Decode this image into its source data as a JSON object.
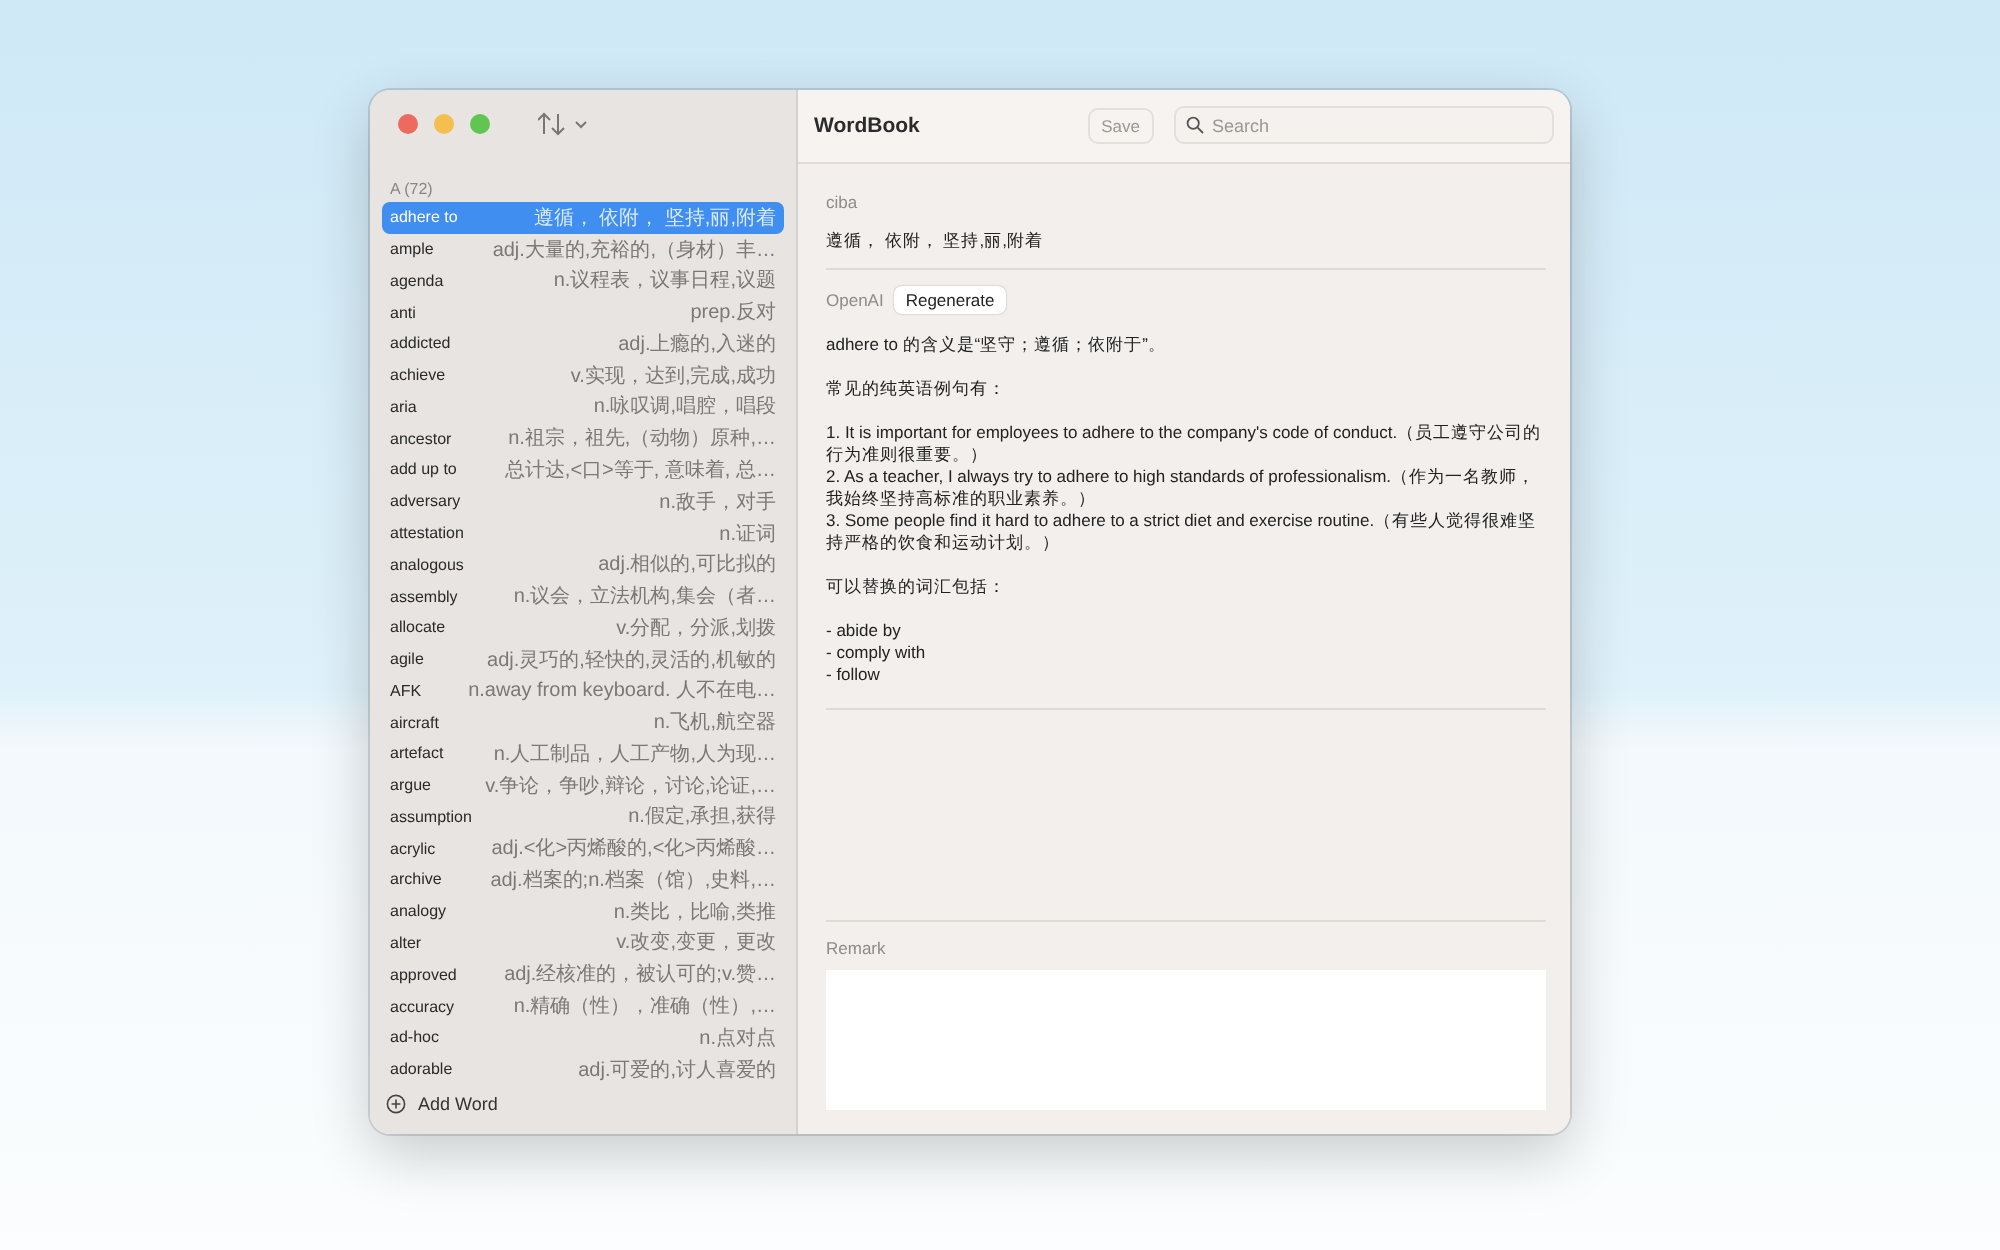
{
  "window": {
    "title": "WordBook"
  },
  "toolbar": {
    "save_label": "Save",
    "search_placeholder": "Search"
  },
  "sidebar": {
    "section": "A (72)",
    "add_label": "Add Word",
    "items": [
      {
        "word": "adhere to",
        "meaning": "遵循， 依附， 坚持,丽,附着",
        "selected": true
      },
      {
        "word": "ample",
        "meaning": "adj.大量的,充裕的,（身材）丰…",
        "selected": false
      },
      {
        "word": "agenda",
        "meaning": "n.议程表，议事日程,议题",
        "selected": false
      },
      {
        "word": "anti",
        "meaning": "prep.反对",
        "selected": false
      },
      {
        "word": "addicted",
        "meaning": "adj.上瘾的,入迷的",
        "selected": false
      },
      {
        "word": "achieve",
        "meaning": "v.实现，达到,完成,成功",
        "selected": false
      },
      {
        "word": "aria",
        "meaning": "n.咏叹调,唱腔，唱段",
        "selected": false
      },
      {
        "word": "ancestor",
        "meaning": "n.祖宗，祖先,（动物）原种,…",
        "selected": false
      },
      {
        "word": "add up to",
        "meaning": "总计达,<口>等于, 意味着, 总…",
        "selected": false
      },
      {
        "word": "adversary",
        "meaning": "n.敌手，对手",
        "selected": false
      },
      {
        "word": "attestation",
        "meaning": "n.证词",
        "selected": false
      },
      {
        "word": "analogous",
        "meaning": "adj.相似的,可比拟的",
        "selected": false
      },
      {
        "word": "assembly",
        "meaning": "n.议会，立法机构,集会（者…",
        "selected": false
      },
      {
        "word": "allocate",
        "meaning": "v.分配，分派,划拨",
        "selected": false
      },
      {
        "word": "agile",
        "meaning": "adj.灵巧的,轻快的,灵活的,机敏的",
        "selected": false
      },
      {
        "word": "AFK",
        "meaning": "n.away from keyboard. 人不在电…",
        "selected": false
      },
      {
        "word": "aircraft",
        "meaning": "n.飞机,航空器",
        "selected": false
      },
      {
        "word": "artefact",
        "meaning": "n.人工制品，人工产物,人为现…",
        "selected": false
      },
      {
        "word": "argue",
        "meaning": "v.争论，争吵,辩论，讨论,论证,…",
        "selected": false
      },
      {
        "word": "assumption",
        "meaning": "n.假定,承担,获得",
        "selected": false
      },
      {
        "word": "acrylic",
        "meaning": "adj.<化>丙烯酸的,<化>丙烯酸…",
        "selected": false
      },
      {
        "word": "archive",
        "meaning": "adj.档案的;n.档案（馆）,史料,…",
        "selected": false
      },
      {
        "word": "analogy",
        "meaning": "n.类比，比喻,类推",
        "selected": false
      },
      {
        "word": "alter",
        "meaning": "v.改变,变更，更改",
        "selected": false
      },
      {
        "word": "approved",
        "meaning": "adj.经核准的，被认可的;v.赞…",
        "selected": false
      },
      {
        "word": "accuracy",
        "meaning": "n.精确（性），准确（性）,…",
        "selected": false
      },
      {
        "word": "ad-hoc",
        "meaning": "n.点对点",
        "selected": false
      },
      {
        "word": "adorable",
        "meaning": "adj.可爱的,讨人喜爱的",
        "selected": false
      }
    ]
  },
  "detail": {
    "source": "ciba",
    "translation": "遵循， 依附， 坚持,丽,附着",
    "ai_label": "OpenAI",
    "regenerate_label": "Regenerate",
    "ai_blocks": [
      [
        "adhere to 的含义是“坚守；遵循；依附于”。"
      ],
      [
        "常见的纯英语例句有："
      ],
      [
        "1. It is important for employees to adhere to the company's code of conduct.（员工遵守公司的行为准则很重要。）",
        "2. As a teacher, I always try to adhere to high standards of professionalism.（作为一名教师，我始终坚持高标准的职业素养。）",
        "3. Some people find it hard to adhere to a strict diet and exercise routine.（有些人觉得很难坚持严格的饮食和运动计划。）"
      ],
      [
        "可以替换的词汇包括："
      ],
      [
        "- abide by",
        "- comply with",
        "- follow"
      ]
    ],
    "remark_label": "Remark"
  }
}
